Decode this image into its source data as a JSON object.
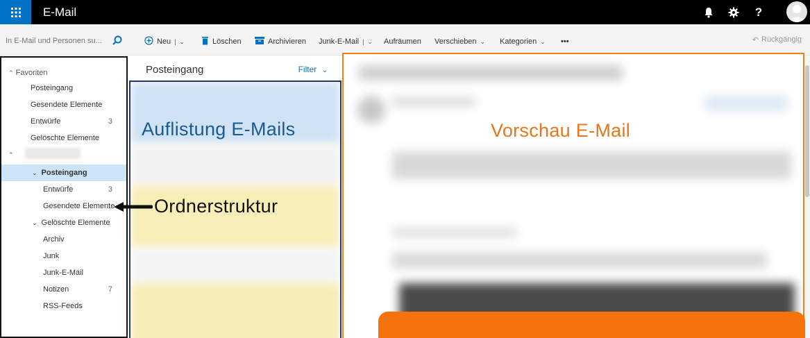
{
  "topbar": {
    "app_title": "E-Mail",
    "icons": [
      "waffle-icon",
      "bell-icon",
      "gear-icon",
      "help-icon",
      "avatar"
    ],
    "help_glyph": "?"
  },
  "search": {
    "placeholder": "In E-Mail und Personen su..."
  },
  "commands": {
    "new": "Neu",
    "delete": "Löschen",
    "archive": "Archivieren",
    "junk": "Junk-E-Mail",
    "sweep": "Aufräumen",
    "move": "Verschieben",
    "categories": "Kategorien",
    "more": "•••",
    "undo": "Rückgängig"
  },
  "folders": {
    "favorites_header": "Favoriten",
    "favorites": [
      {
        "label": "Posteingang",
        "count": ""
      },
      {
        "label": "Gesendete Elemente",
        "count": ""
      },
      {
        "label": "Entwürfe",
        "count": "3"
      },
      {
        "label": "Gelöschte Elemente",
        "count": ""
      }
    ],
    "account": [
      {
        "label": "Posteingang",
        "count": ""
      },
      {
        "label": "Entwürfe",
        "count": "3"
      },
      {
        "label": "Gesendete Elemente",
        "count": ""
      },
      {
        "label": "Gelöschte Elemente",
        "count": ""
      },
      {
        "label": "Archiv",
        "count": ""
      },
      {
        "label": "Junk",
        "count": ""
      },
      {
        "label": "Junk-E-Mail",
        "count": ""
      },
      {
        "label": "Notizen",
        "count": "7"
      },
      {
        "label": "RSS-Feeds",
        "count": ""
      }
    ]
  },
  "message_list": {
    "title": "Posteingang",
    "filter": "Filter"
  },
  "annotations": {
    "list": "Auflistung E-Mails",
    "preview": "Vorschau E-Mail",
    "folders": "Ordnerstruktur"
  },
  "colors": {
    "accent": "#0072c6",
    "list_frame": "#243a5e",
    "preview_frame": "#f07f17",
    "highlight": "#f6730b"
  }
}
